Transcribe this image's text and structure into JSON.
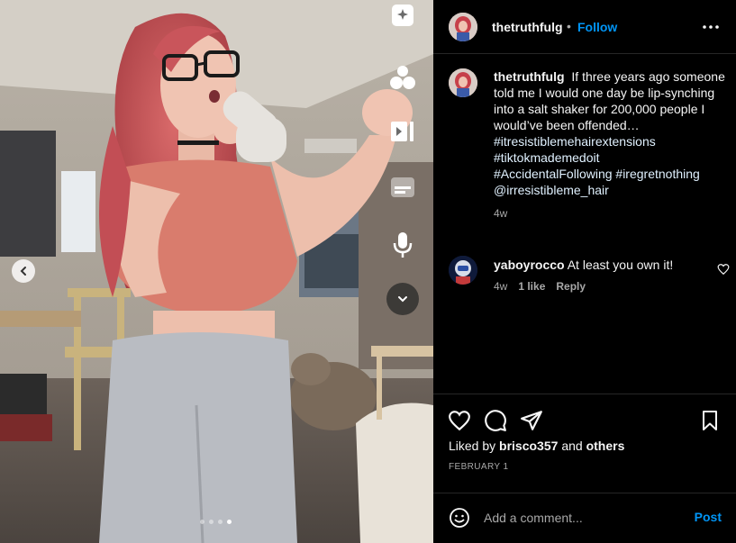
{
  "post": {
    "username": "thetruthfulg",
    "follow_label": "Follow",
    "separator": "•",
    "caption_intro": "If three years ago someone told me I would one day be lip-synching into a salt shaker for 200,000 people I would’ve been offended…",
    "hashtags": [
      "#itresistiblemehairextensions",
      "#tiktokmademedoit",
      "#AccidentalFollowing #iregretnothing",
      "@irresistibleme_hair"
    ],
    "caption_time": "4w"
  },
  "comments": [
    {
      "username": "yaboyrocco",
      "text": "At least you own it!",
      "time": "4w",
      "likes": "1 like",
      "reply_label": "Reply"
    }
  ],
  "engagement": {
    "liked_by_prefix": "Liked by",
    "liked_by_user": "brisco357",
    "liked_by_and": "and",
    "liked_by_others": "others",
    "date": "FEBRUARY 1"
  },
  "composer": {
    "placeholder": "Add a comment...",
    "post_label": "Post"
  },
  "media": {
    "icons": [
      "sparkle-icon",
      "shapes-icon",
      "video-skip-icon",
      "captions-icon",
      "voice-icon"
    ],
    "carousel_total": 4,
    "carousel_active": 4
  },
  "colors": {
    "accent": "#0095f6",
    "background": "#000000",
    "secondary_text": "#a8a8a8",
    "divider": "#262626"
  }
}
